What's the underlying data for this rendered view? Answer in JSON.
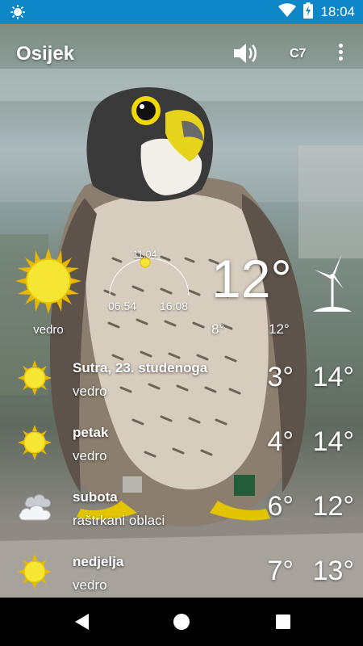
{
  "status_bar": {
    "time": "18:04",
    "icons": [
      "weather-notification-icon",
      "wifi-icon",
      "battery-charging-icon"
    ]
  },
  "header": {
    "city": "Osijek",
    "unit_label": "C7",
    "icons": [
      "speaker-icon",
      "more-options-icon"
    ]
  },
  "current": {
    "condition": "vedro",
    "temperature": "12°",
    "min_temp": "8°",
    "max_temp": "12°",
    "solar_noon": "11.04",
    "sunrise": "06.54",
    "sunset": "16.08",
    "icons": [
      "sun-icon",
      "wind-turbine-icon"
    ]
  },
  "forecast": [
    {
      "day": "Sutra, 23. studenoga",
      "condition": "vedro",
      "min": "3°",
      "max": "14°",
      "icon": "sun-icon"
    },
    {
      "day": "petak",
      "condition": "vedro",
      "min": "4°",
      "max": "14°",
      "icon": "sun-icon"
    },
    {
      "day": "subota",
      "condition": "raštrkani oblaci",
      "min": "6°",
      "max": "12°",
      "icon": "cloud-icon"
    },
    {
      "day": "nedjelja",
      "condition": "vedro",
      "min": "7°",
      "max": "13°",
      "icon": "sun-icon"
    }
  ],
  "colors": {
    "status_bar": "#0d87c8",
    "sun": "#f5e634",
    "sun_rays": "#e8b700",
    "nav_bar": "#000000"
  }
}
